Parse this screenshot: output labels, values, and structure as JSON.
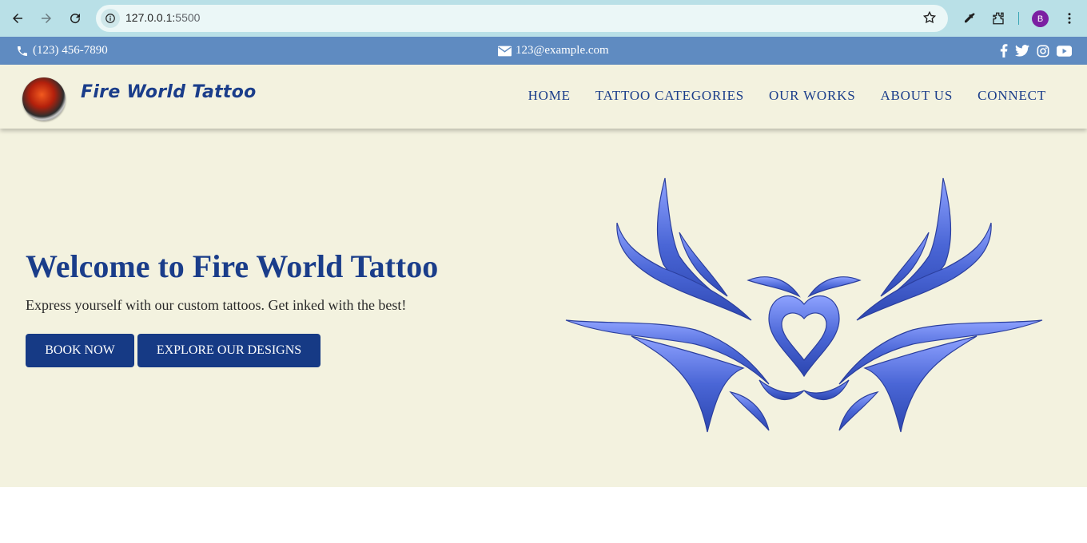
{
  "browser": {
    "url_host": "127.0.0.1:",
    "url_port": "5500",
    "avatar_letter": "B",
    "icons": [
      "back-icon",
      "forward-icon",
      "reload-icon",
      "info-icon",
      "star-icon",
      "eyedropper-icon",
      "extensions-icon",
      "menu-dots-icon"
    ]
  },
  "topbar": {
    "phone": "(123) 456-7890",
    "email": "123@example.com",
    "socials": [
      "facebook-icon",
      "twitter-icon",
      "instagram-icon",
      "youtube-icon"
    ]
  },
  "header": {
    "brand": "Fire World Tattoo",
    "menu": [
      "HOME",
      "TATTOO CATEGORIES",
      "OUR WORKS",
      "ABOUT US",
      "CONNECT"
    ]
  },
  "hero": {
    "title": "Welcome to Fire World Tattoo",
    "subtitle": "Express yourself with our custom tattoos. Get inked with the best!",
    "book_label": "BOOK NOW",
    "explore_label": "EXPLORE OUR DESIGNS"
  },
  "colors": {
    "browser_bar": "#b9e0e7",
    "topbar": "#5f8bc1",
    "header_bg": "#f3f2df",
    "brand_blue": "#1a3d8a",
    "button_blue": "#163a85",
    "tattoo_blue": "#4a66d6"
  }
}
